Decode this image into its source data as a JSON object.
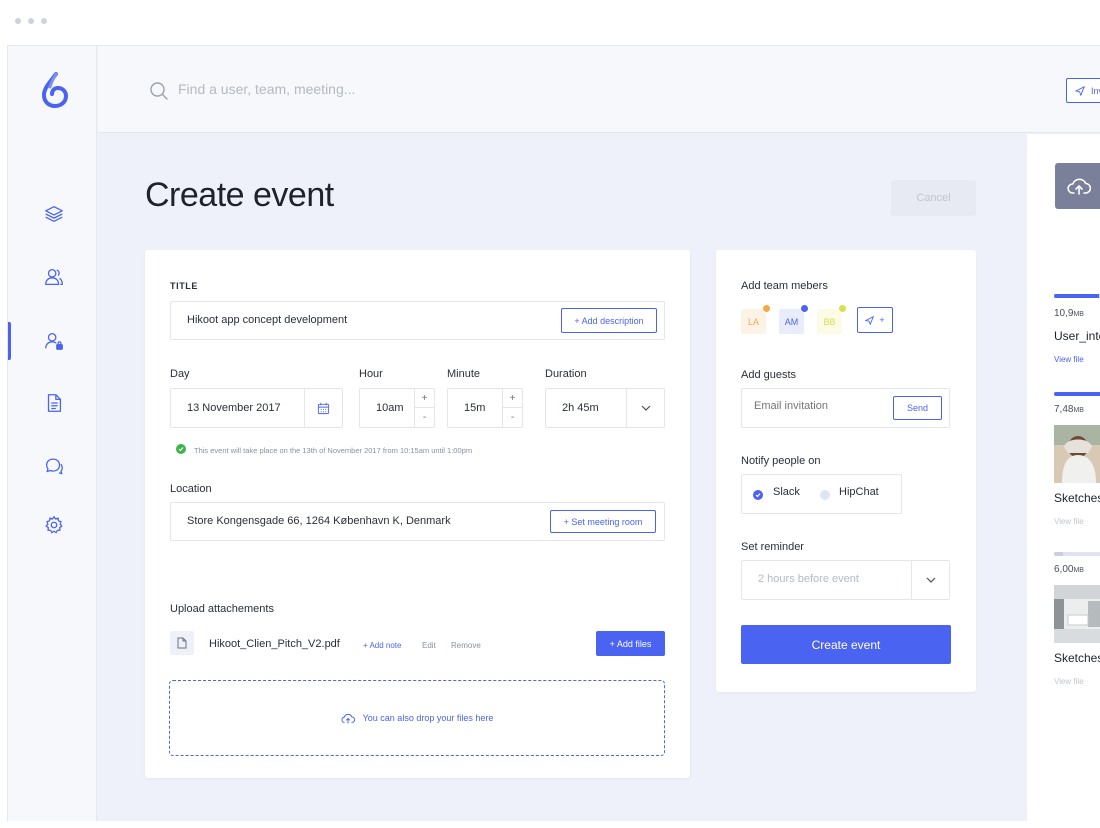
{
  "search": {
    "placeholder": "Find a user, team, meeting..."
  },
  "topbar": {
    "invite_label": "Invi"
  },
  "page": {
    "title": "Create event",
    "cancel_label": "Cancel"
  },
  "form": {
    "title_label": "TITLE",
    "title_value": "Hikoot app concept development",
    "add_description_label": "+ Add description",
    "day_label": "Day",
    "day_value": "13 November 2017",
    "hour_label": "Hour",
    "hour_value": "10am",
    "minute_label": "Minute",
    "minute_value": "15m",
    "duration_label": "Duration",
    "duration_value": "2h 45m",
    "stepper_plus": "+",
    "stepper_minus": "-",
    "summary_note": "This event will take place on the 13th of November 2017 from 10:15am until 1:00pm",
    "location_label": "Location",
    "location_value": "Store Kongensgade 66, 1264 København K, Denmark",
    "set_room_label": "+ Set meeting room",
    "attachments_label": "Upload attachements",
    "attachment_name": "Hikoot_Clien_Pitch_V2.pdf",
    "add_note_label": "+ Add note",
    "edit_label": "Edit",
    "remove_label": "Remove",
    "add_files_label": "+ Add files",
    "drop_label": "You can also drop your files here"
  },
  "side_form": {
    "team_label": "Add team mebers",
    "members": [
      {
        "initials": "LA",
        "color": "#f5a74b",
        "bg": "#fdf2e6"
      },
      {
        "initials": "AM",
        "color": "#4a63f0",
        "bg": "#e9ecfb"
      },
      {
        "initials": "BB",
        "color": "#d9e04a",
        "bg": "#fbfbe6"
      }
    ],
    "add_member_label": "+",
    "guests_label": "Add guests",
    "guests_placeholder": "Email invitation",
    "send_label": "Send",
    "notify_label": "Notify people on",
    "notify_options": [
      "Slack",
      "HipChat"
    ],
    "notify_selected": "Slack",
    "reminder_label": "Set reminder",
    "reminder_value": "2 hours before event",
    "submit_label": "Create event"
  },
  "files_pane": {
    "files": [
      {
        "size": "10,9",
        "unit": "MB",
        "name": "User_inte",
        "view": "View file",
        "progress": 0.75,
        "thumb": "none"
      },
      {
        "size": "7,48",
        "unit": "MB",
        "name": "Sketches",
        "view": "View file",
        "progress": 0.9,
        "thumb": "person"
      },
      {
        "size": "6,00",
        "unit": "MB",
        "name": "Sketches",
        "view": "View file",
        "progress": 0.15,
        "thumb": "office"
      }
    ]
  },
  "colors": {
    "accent": "#4a63f0",
    "success": "#3bb54a",
    "background": "#eef1f9"
  }
}
